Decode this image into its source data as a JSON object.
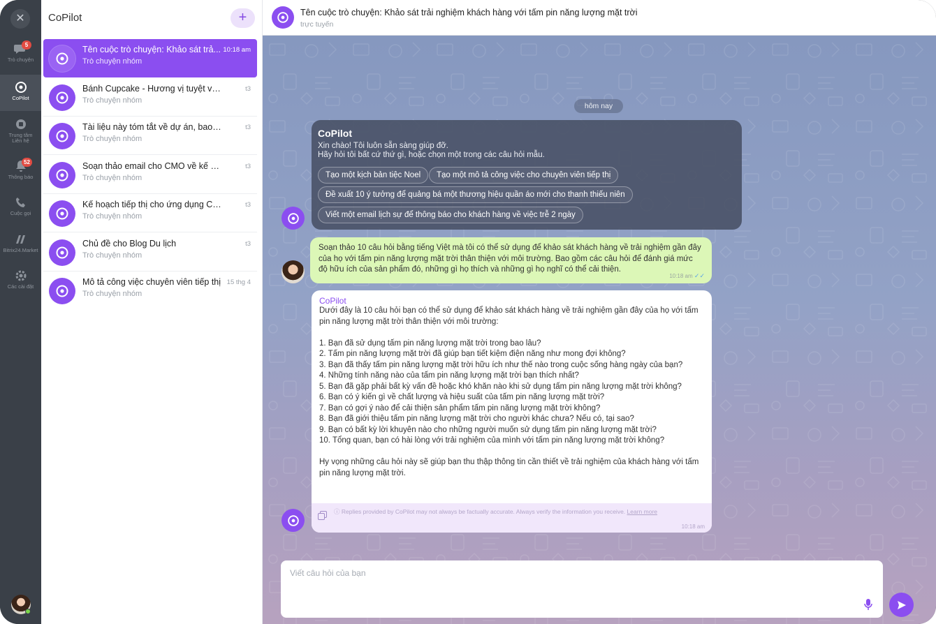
{
  "rail": {
    "items": [
      {
        "label": "Trò chuyện",
        "badge": "5",
        "icon": "chat-icon"
      },
      {
        "label": "CoPilot",
        "icon": "copilot-icon"
      },
      {
        "label": "Trung tâm\nLiên hệ",
        "icon": "contact-center-icon"
      },
      {
        "label": "Thông báo",
        "badge": "52",
        "icon": "bell-icon"
      },
      {
        "label": "Cuộc gọi",
        "icon": "phone-icon"
      },
      {
        "label": "Bitrix24.Market",
        "icon": "market-icon"
      },
      {
        "label": "Các cài đặt",
        "icon": "gear-icon"
      }
    ]
  },
  "list": {
    "title": "CoPilot",
    "add_label": "+",
    "chats": [
      {
        "title": "Tên cuộc trò chuyện: Khảo sát trả...",
        "subtitle": "Trò chuyện nhóm",
        "time": "10:18 am"
      },
      {
        "title": "Bánh Cupcake - Hương vị tuyệt vời cho ...",
        "subtitle": "Trò chuyện nhóm",
        "time": "t3"
      },
      {
        "title": "Tài liệu này tóm tắt về dự án, bao gồm ...",
        "subtitle": "Trò chuyện nhóm",
        "time": "t3"
      },
      {
        "title": "Soạn thảo email cho CMO về kế hoạch ...",
        "subtitle": "Trò chuyện nhóm",
        "time": "t3"
      },
      {
        "title": "Kế hoạch tiếp thị cho ứng dụng CRM vớ...",
        "subtitle": "Trò chuyện nhóm",
        "time": "t3"
      },
      {
        "title": "Chủ đề cho Blog Du lịch",
        "subtitle": "Trò chuyện nhóm",
        "time": "t3"
      },
      {
        "title": "Mô tả công việc chuyên viên tiếp thị",
        "subtitle": "Trò chuyện nhóm",
        "time": "15 thg 4"
      }
    ]
  },
  "conversation": {
    "title": "Tên cuộc trò chuyện: Khảo sát trải nghiệm khách hàng với tấm pin năng lượng mặt trời",
    "status": "trực tuyến",
    "date_divider": "hôm nay",
    "welcome": {
      "name": "CoPilot",
      "line1": "Xin chào! Tôi luôn sẵn sàng giúp đỡ.",
      "line2": "Hãy hỏi tôi bất cứ thứ gì, hoặc chọn một trong các câu hỏi mẫu.",
      "chips": [
        "Tạo một kịch bản tiệc Noel",
        "Tạo một mô tả công việc cho chuyên viên tiếp thị",
        "Đề xuất 10 ý tưởng để quảng bá một thương hiệu quần áo mới cho thanh thiếu niên",
        "Viết một email lịch sự để thông báo cho khách hàng về việc trễ 2 ngày"
      ]
    },
    "user_message": {
      "text": "Soạn thảo 10 câu hỏi bằng tiếng Việt mà tôi có thể sử dụng để khảo sát khách hàng về trải nghiệm gần đây của họ với tấm pin năng lượng mặt trời thân thiện với môi trường. Bao gồm các câu hỏi để đánh giá mức độ hữu ích của sản phẩm đó, những gì họ thích và những gì họ nghĩ có thể cải thiện.",
      "time": "10:18 am"
    },
    "bot_message": {
      "name": "CoPilot",
      "intro": "Dưới đây là 10 câu hỏi bạn có thể sử dụng để khảo sát khách hàng về trải nghiệm gần đây của họ với tấm pin năng lượng mặt trời thân thiện với môi trường:",
      "questions": [
        "1. Bạn đã sử dụng tấm pin năng lượng mặt trời trong bao lâu?",
        "2. Tấm pin năng lượng mặt trời đã giúp bạn tiết kiệm điện năng như mong đợi không?",
        "3. Bạn đã thấy tấm pin năng lượng mặt trời hữu ích như thế nào trong cuộc sống hàng ngày của bạn?",
        "4. Những tính năng nào của tấm pin năng lượng mặt trời bạn thích nhất?",
        "5. Bạn đã gặp phải bất kỳ vấn đề hoặc khó khăn nào khi sử dụng tấm pin năng lượng mặt trời không?",
        "6. Bạn có ý kiến gì về chất lượng và hiệu suất của tấm pin năng lượng mặt trời?",
        "7. Bạn có gợi ý nào để cải thiện sản phẩm tấm pin năng lượng mặt trời không?",
        "8. Bạn đã giới thiệu tấm pin năng lượng mặt trời cho người khác chưa? Nếu có, tại sao?",
        "9. Bạn có bất kỳ lời khuyên nào cho những người muốn sử dụng tấm pin năng lượng mặt trời?",
        "10. Tổng quan, bạn có hài lòng với trải nghiệm của mình với tấm pin năng lượng mặt trời không?"
      ],
      "closing": "Hy vọng những câu hỏi này sẽ giúp bạn thu thập thông tin cần thiết về trải nghiệm của khách hàng với tấm pin năng lượng mặt trời.",
      "disclaimer": "ⓘ  Replies provided by CoPilot may not always be factually accurate. Always verify the information you receive.",
      "learn_more": "Learn more",
      "time": "10:18 am"
    },
    "composer": {
      "placeholder": "Viết câu hỏi của bạn"
    }
  },
  "colors": {
    "accent": "#8b4ef0",
    "rail_bg": "#3a4048",
    "user_bubble": "#dcf7b7",
    "badge": "#e14b42"
  }
}
